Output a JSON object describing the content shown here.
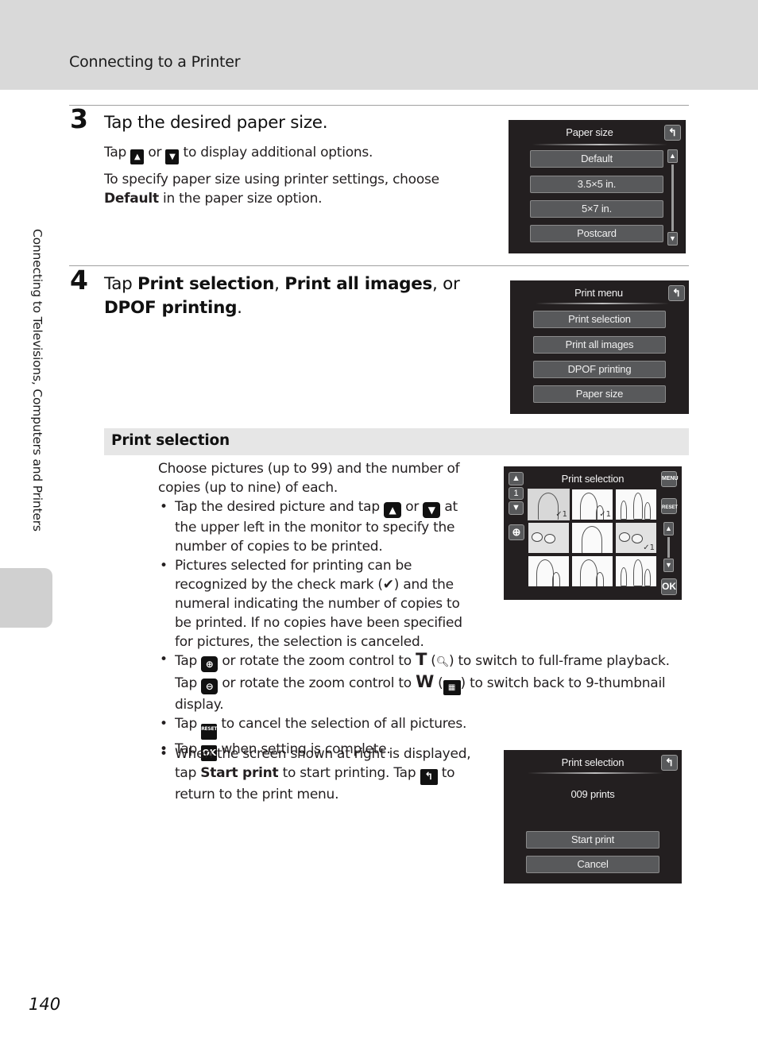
{
  "header": {
    "title": "Connecting to a Printer"
  },
  "side_tab": {
    "label": "Connecting to Televisions, Computers and Printers"
  },
  "step3": {
    "number": "3",
    "title": "Tap the desired paper size.",
    "line1_pre": "Tap",
    "line1_mid": "or",
    "line1_post": "to display additional options.",
    "up_icon": "▲",
    "down_icon": "▼",
    "line2_pre": "To specify paper size using printer settings, choose",
    "line2_bold": "Default",
    "line2_post": "in the paper size option."
  },
  "paper_size_screen": {
    "title": "Paper size",
    "back_icon": "↰",
    "options": [
      "Default",
      "3.5×5 in.",
      "5×7 in.",
      "Postcard"
    ],
    "scroll_up": "▲",
    "scroll_down": "▼"
  },
  "step4": {
    "number": "4",
    "title_pre": "Tap",
    "bold1": "Print selection",
    "sep1": ",",
    "bold2": "Print all images",
    "sep2": ", or",
    "bold3": "DPOF printing",
    "end": "."
  },
  "print_menu_screen": {
    "title": "Print menu",
    "back_icon": "↰",
    "options": [
      "Print selection",
      "Print all images",
      "DPOF printing",
      "Paper size"
    ]
  },
  "print_selection": {
    "heading": "Print selection",
    "intro": "Choose pictures (up to 99) and the number of copies (up to nine) of each.",
    "bullets": {
      "b1_pre": "Tap the desired picture and tap",
      "b1_mid": "or",
      "b1_post": "at the upper left in the monitor to specify the number of copies to be printed.",
      "b1_up": "▲",
      "b1_down": "▼",
      "b2_pre": "Pictures selected for printing can be recognized by the check mark (",
      "b2_icon": "✔",
      "b2_post": ") and the numeral indicating the number of copies to be printed. If no copies have been specified for pictures, the selection is canceled.",
      "b3_a": "Tap",
      "b3_zoom_in": "⊕",
      "b3_b": "or rotate the zoom control to",
      "b3_T": "T",
      "b3_c": "(",
      "b3_mag": "🔍︎",
      "b3_d": ") to switch to full-frame playback.",
      "b3_e": "Tap",
      "b3_zoom_out": "⊖",
      "b3_f": "or rotate the zoom control to",
      "b3_W": "W",
      "b3_g": "(",
      "b3_thumb": "▦",
      "b3_h": ") to switch back to 9-thumbnail display.",
      "b4_pre": "Tap",
      "b4_icon": "RESET",
      "b4_post": "to cancel the selection of all pictures.",
      "b5_pre": "Tap",
      "b5_icon": "OK",
      "b5_post": "when setting is complete.",
      "b6_pre": "When the screen shown at right is displayed, tap",
      "b6_bold": "Start print",
      "b6_mid": "to start printing. Tap",
      "b6_icon": "↰",
      "b6_post": "to return to the print menu."
    }
  },
  "selection_screen": {
    "title": "Print selection",
    "up": "▲",
    "count": "1",
    "down": "▼",
    "zoom_icon": "⊕",
    "menu_label": "MENU",
    "reset_label": "RESET",
    "scroll_up": "▲",
    "scroll_down": "▼",
    "ok_label": "OK",
    "thumbnails": [
      {
        "subject": "woman portrait",
        "selected": true,
        "copies": "1"
      },
      {
        "subject": "woman with child",
        "selected": false,
        "copies": "1"
      },
      {
        "subject": "family",
        "selected": false,
        "copies": ""
      },
      {
        "subject": "flowers",
        "selected": false,
        "copies": ""
      },
      {
        "subject": "woman portrait",
        "selected": false,
        "copies": ""
      },
      {
        "subject": "flowers",
        "selected": false,
        "copies": "1"
      },
      {
        "subject": "woman with child",
        "selected": false,
        "copies": ""
      },
      {
        "subject": "woman with child",
        "selected": false,
        "copies": ""
      },
      {
        "subject": "family",
        "selected": false,
        "copies": ""
      }
    ]
  },
  "start_screen": {
    "title": "Print selection",
    "back_icon": "↰",
    "prints": "009 prints",
    "start_label": "Start print",
    "cancel_label": "Cancel"
  },
  "footer": {
    "page_number": "140"
  }
}
